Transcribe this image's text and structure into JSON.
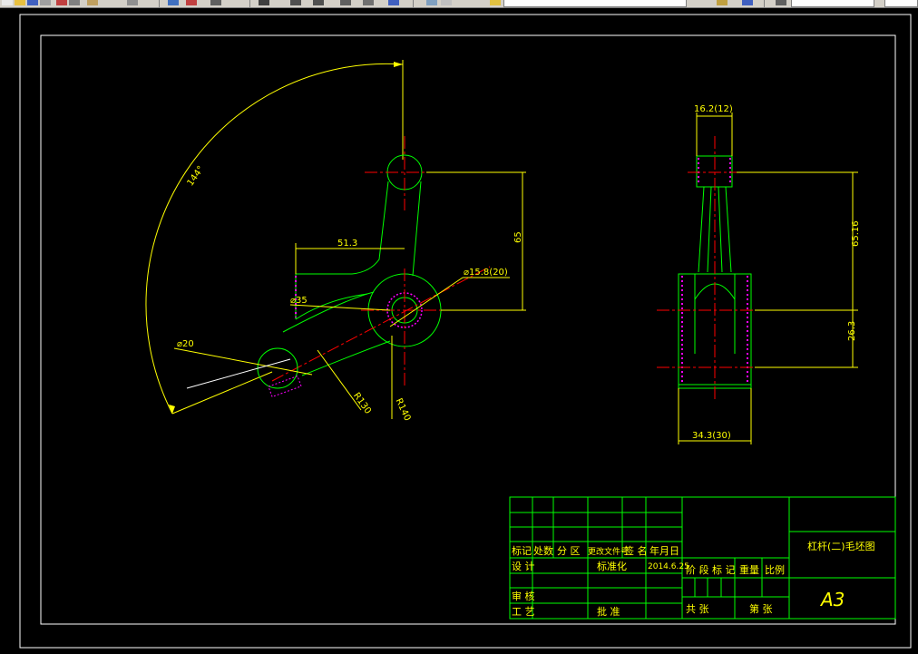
{
  "toolbar": {
    "layer_name": "",
    "icons": [
      "new-icon",
      "open-icon",
      "save-icon",
      "print-icon",
      "cut-icon",
      "copy-icon",
      "paste-icon",
      "undo-icon",
      "redo-icon",
      "pan-icon",
      "zoom-icon",
      "zoom-window-icon",
      "layer-icon",
      "properties-icon",
      "layer-dropdown",
      "color-icon",
      "linetype-icon"
    ]
  },
  "drawing": {
    "dims": {
      "angle": "144°",
      "offset_x": "51.3",
      "height_main": "65",
      "bore": "⌀15.8(20)",
      "boss_dia": "⌀35",
      "small_dia": "⌀20",
      "radius_inner": "R130",
      "radius_outer": "R140",
      "side_top_width": "16.2(12)",
      "side_height": "65.16",
      "side_lower": "26.3",
      "side_bottom_width": "34.3(30)"
    }
  },
  "title_block": {
    "rev_headers": [
      "标记",
      "处数",
      "分 区",
      "更改文件号",
      "签 名",
      "年月日"
    ],
    "design": "设 计",
    "designer": "",
    "standardize": "标准化",
    "date": "2014.6.25",
    "stage_mark": "阶 段 标 记",
    "weight": "重量",
    "scale": "比例",
    "scale_value": "",
    "review": "审 核",
    "process": "工 艺",
    "approve": "批 准",
    "total_sheets": "共  张",
    "sheet_no": "第  张",
    "company": "",
    "part_title": "杠杆(二)毛坯图",
    "size": "A3"
  },
  "colors": {
    "outline": "#00ff00",
    "dimension": "#ffff00",
    "center": "#ff0000",
    "hatch": "#ff00ff",
    "frame": "#ffffff"
  }
}
